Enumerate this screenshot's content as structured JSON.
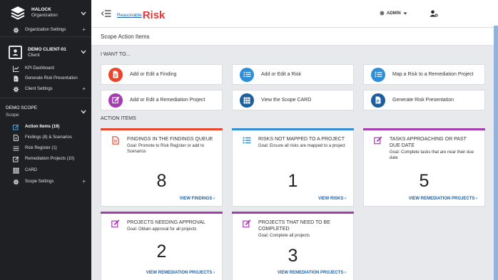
{
  "sidebar": {
    "org_name": "HALOCK",
    "org_sub": "Organization",
    "org_settings": "Organization Settings",
    "client_name": "DEMO CLIENT-01",
    "client_sub": "Client",
    "kpi": "KPI Dashboard",
    "gen_risk": "Generate Risk Presentation",
    "client_settings": "Client Settings",
    "scope_name": "DEMO SCOPE",
    "scope_sub": "Scope",
    "action_items": "Action Items (19)",
    "findings": "Findings (8) & Scenarios",
    "risk_register": "Risk Register (1)",
    "remediation": "Remediation Projects (10)",
    "card": "CARD",
    "scope_settings": "Scope Settings",
    "plus": "+"
  },
  "topbar": {
    "brand_small": "Reasonable",
    "brand_big": "Risk",
    "admin": "ADMIN"
  },
  "page": {
    "title": "Scope Action Items",
    "i_want_to": "I WANT TO...",
    "action_items": "ACTION ITEMS"
  },
  "quick_actions": [
    {
      "label": "Add or Edit a Finding"
    },
    {
      "label": "Add or Edit a Risk"
    },
    {
      "label": "Map a Risk to a Remediation Project"
    },
    {
      "label": "Add or Edit a Remediation Project"
    },
    {
      "label": "View the Scope CARD"
    },
    {
      "label": "Generate Risk Presentation"
    }
  ],
  "cards": [
    {
      "title": "FINDINGS IN THE FINDINGS QUEUE",
      "goal": "Goal: Promote to Risk Register or add to Scenarios",
      "count": "8",
      "link": "VIEW FINDINGS ›"
    },
    {
      "title": "RISKS NOT MAPPED TO A PROJECT",
      "goal": "Goal: Ensure all risks are mapped to a project",
      "count": "1",
      "link": "VIEW RISKS ›"
    },
    {
      "title": "TASKS APPROACHING OR PAST DUE DATE",
      "goal": "Goal: Complete tasks that are near their due date",
      "count": "5",
      "link": "VIEW REMEDIATION PROJECTS ›"
    },
    {
      "title": "PROJECTS NEEDING APPROVAL",
      "goal": "Goal: Obtain approval for all projects",
      "count": "2",
      "link": "VIEW REMEDIATION PROJECTS ›"
    },
    {
      "title": "PROJECTS THAT NEED TO BE COMPLETED",
      "goal": "Goal: Complete all projects",
      "count": "3",
      "link": "VIEW REMEDIATION PROJECTS ›"
    }
  ],
  "colors": {
    "sidebar_bg": "#1f2024",
    "brand_red": "#e0373b",
    "link_blue": "#1a62b0",
    "finding_red": "#e8452c",
    "risk_blue": "#2e8fd8",
    "project_purple": "#a43db0",
    "card_navy": "#1c5e9e"
  }
}
